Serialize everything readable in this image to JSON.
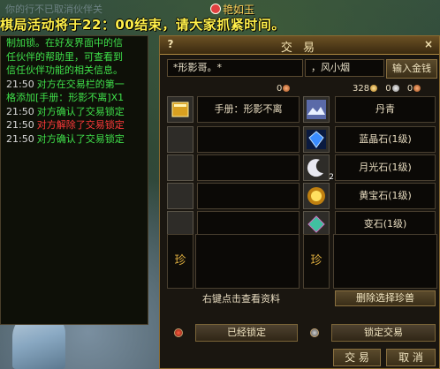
{
  "scene": {
    "faded_text": "你的行不已取消伙伴关",
    "npc_name": "艳如玉",
    "announcement": "棋局活动将于22：00结束，请大家抓紧时间。"
  },
  "chat": {
    "lines": [
      {
        "time": "",
        "text": "制加锁。在好友界面中的信",
        "style": "sys"
      },
      {
        "time": "",
        "text": "任伙伴的帮助里，可查看到",
        "style": "sys"
      },
      {
        "time": "",
        "text": "信任伙伴功能的相关信息。",
        "style": "sys"
      },
      {
        "time": "21:50",
        "text": "对方在交易栏的第一",
        "style": "sys"
      },
      {
        "time": "",
        "text": "格添加[手册：形影不离]X1",
        "style": "sys"
      },
      {
        "time": "21:50",
        "text": "对方确认了交易锁定",
        "style": "sys"
      },
      {
        "time": "21:50",
        "text": "对方解除了交易锁定",
        "style": "red"
      },
      {
        "time": "21:50",
        "text": "对方确认了交易锁定",
        "style": "sys"
      }
    ]
  },
  "trade": {
    "title": "交 易",
    "help": "?",
    "close": "×",
    "left_name": "*形影哥。*",
    "right_name": "，风小烟",
    "input_gold_label": "输入金钱",
    "left_money": "0",
    "right_money_gold": "328",
    "right_money_silver": "0",
    "right_money_copper": "0",
    "left_items": [
      {
        "name": "手册：形影不离",
        "icon": "golden-book-icon"
      },
      {
        "name": "",
        "icon": ""
      },
      {
        "name": "",
        "icon": ""
      },
      {
        "name": "",
        "icon": ""
      },
      {
        "name": "",
        "icon": ""
      }
    ],
    "right_items": [
      {
        "name": "丹青",
        "icon": "painting-icon",
        "qty": ""
      },
      {
        "name": "蓝晶石(1级)",
        "icon": "blue-crystal-icon",
        "qty": ""
      },
      {
        "name": "月光石(1级)",
        "icon": "moonstone-icon",
        "qty": "2"
      },
      {
        "name": "黄宝石(1级)",
        "icon": "topaz-icon",
        "qty": ""
      },
      {
        "name": "变石(1级)",
        "icon": "alexandrite-icon",
        "qty": ""
      }
    ],
    "zhen_label": "珍",
    "hint": "右键点击查看资料",
    "delete_pet_label": "删除选择珍兽",
    "left_lock_label": "已经锁定",
    "right_lock_label": "锁定交易",
    "trade_button": "交 易",
    "cancel_button": "取 消"
  }
}
